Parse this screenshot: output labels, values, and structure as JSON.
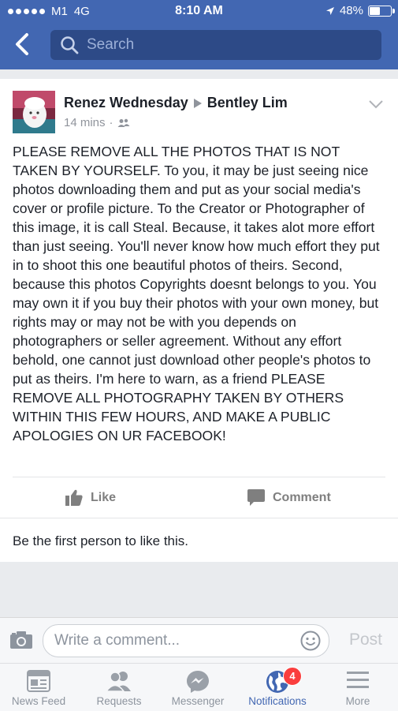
{
  "status_bar": {
    "carrier": "M1",
    "network": "4G",
    "time": "8:10 AM",
    "battery": "48%",
    "battery_level": 0.48
  },
  "header": {
    "search_placeholder": "Search"
  },
  "post": {
    "author": "Renez Wednesday",
    "target": "Bentley Lim",
    "time": "14 mins",
    "audience_icon": "friends-icon",
    "text": "PLEASE REMOVE ALL THE PHOTOS THAT IS NOT TAKEN BY YOURSELF. To you, it may be just seeing nice photos downloading them and put as your social media's cover or profile picture. To the Creator or Photographer of this image, it is call Steal. Because, it takes alot more effort than just seeing. You'll never know how much effort they put in to shoot this one beautiful photos of theirs. Second, because this photos Copyrights doesnt belongs to you. You may own it if you buy their photos with your own money, but rights may or may not be with you depends on photographers or seller agreement. Without any effort behold, one cannot just download other people's photos to put as theirs. I'm here to warn, as a friend PLEASE REMOVE ALL PHOTOGRAPHY TAKEN BY OTHERS WITHIN THIS FEW HOURS, AND MAKE A PUBLIC APOLOGIES ON UR FACEBOOK!",
    "like_label": "Like",
    "comment_label": "Comment",
    "likes_text": "Be the first person to like this."
  },
  "composer": {
    "placeholder": "Write a comment...",
    "post_label": "Post"
  },
  "tabs": [
    {
      "label": "News Feed",
      "icon": "news-feed-icon"
    },
    {
      "label": "Requests",
      "icon": "friend-requests-icon"
    },
    {
      "label": "Messenger",
      "icon": "messenger-icon"
    },
    {
      "label": "Notifications",
      "icon": "globe-icon",
      "badge": "4",
      "active": true
    },
    {
      "label": "More",
      "icon": "menu-icon"
    }
  ],
  "colors": {
    "brand": "#4267b2",
    "badge": "#fa3e3e"
  }
}
